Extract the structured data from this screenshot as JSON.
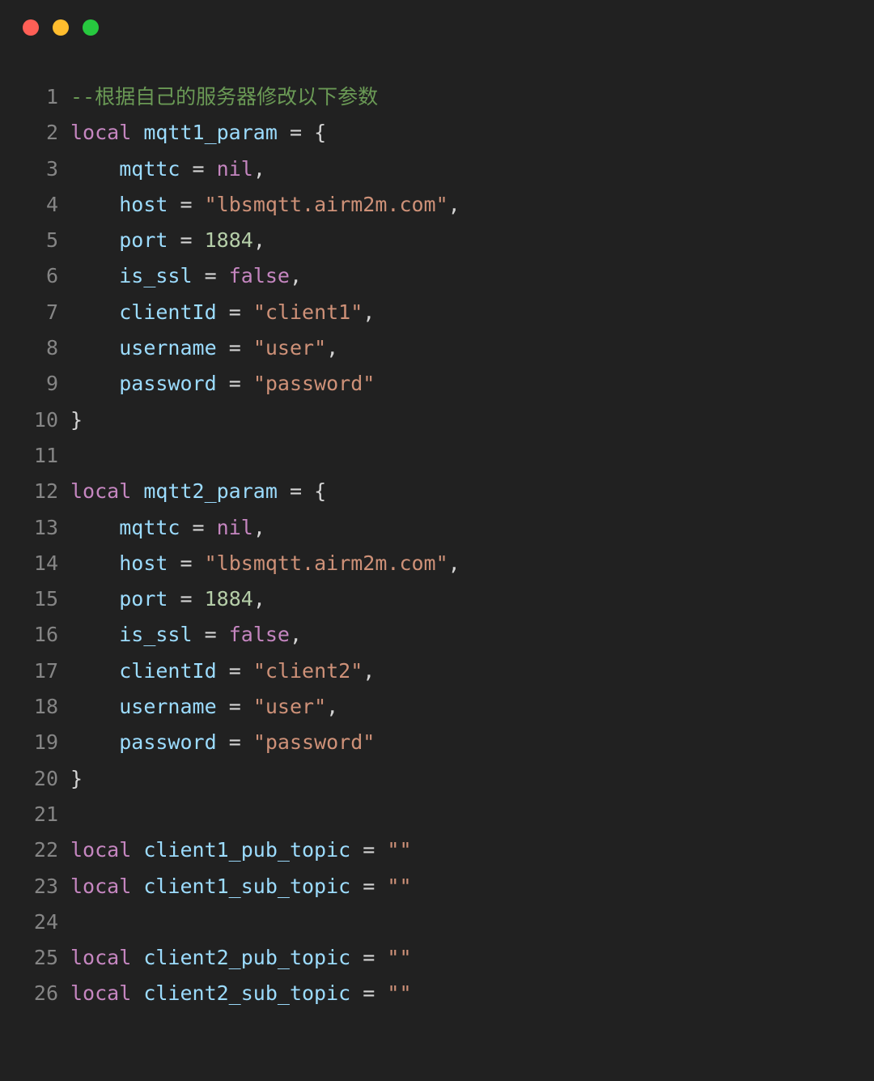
{
  "window": {
    "titlebar": {
      "buttons": [
        {
          "name": "close-button",
          "icon": "circle-icon",
          "color": "#FF5F56",
          "label": ""
        },
        {
          "name": "minimize-button",
          "icon": "circle-icon",
          "color": "#FFBD2E",
          "label": ""
        },
        {
          "name": "maximize-button",
          "icon": "circle-icon",
          "color": "#27C93F",
          "label": ""
        }
      ]
    },
    "theme": {
      "background": "#212121",
      "gutter_color": "#858585",
      "default_text": "#D4D4D4",
      "comment": "#6A9955",
      "keyword": "#C586C0",
      "identifier": "#9CDCFE",
      "string": "#CE9178",
      "number": "#B5CEA8"
    }
  },
  "editor": {
    "language": "lua",
    "first_line_number": 1,
    "last_line_number": 26,
    "lines": [
      {
        "n": "1",
        "tokens": [
          {
            "t": "--根据自己的服务器修改以下参数",
            "c": "comment"
          }
        ]
      },
      {
        "n": "2",
        "tokens": [
          {
            "t": "local",
            "c": "keyword"
          },
          {
            "t": " ",
            "c": "plain"
          },
          {
            "t": "mqtt1_param",
            "c": "ident"
          },
          {
            "t": " ",
            "c": "plain"
          },
          {
            "t": "=",
            "c": "operator"
          },
          {
            "t": " ",
            "c": "plain"
          },
          {
            "t": "{",
            "c": "punct"
          }
        ]
      },
      {
        "n": "3",
        "tokens": [
          {
            "t": "    ",
            "c": "plain"
          },
          {
            "t": "mqttc",
            "c": "ident"
          },
          {
            "t": " ",
            "c": "plain"
          },
          {
            "t": "=",
            "c": "operator"
          },
          {
            "t": " ",
            "c": "plain"
          },
          {
            "t": "nil",
            "c": "keyword"
          },
          {
            "t": ",",
            "c": "punct"
          }
        ]
      },
      {
        "n": "4",
        "tokens": [
          {
            "t": "    ",
            "c": "plain"
          },
          {
            "t": "host",
            "c": "ident"
          },
          {
            "t": " ",
            "c": "plain"
          },
          {
            "t": "=",
            "c": "operator"
          },
          {
            "t": " ",
            "c": "plain"
          },
          {
            "t": "\"lbsmqtt.airm2m.com\"",
            "c": "string"
          },
          {
            "t": ",",
            "c": "punct"
          }
        ]
      },
      {
        "n": "5",
        "tokens": [
          {
            "t": "    ",
            "c": "plain"
          },
          {
            "t": "port",
            "c": "ident"
          },
          {
            "t": " ",
            "c": "plain"
          },
          {
            "t": "=",
            "c": "operator"
          },
          {
            "t": " ",
            "c": "plain"
          },
          {
            "t": "1884",
            "c": "number"
          },
          {
            "t": ",",
            "c": "punct"
          }
        ]
      },
      {
        "n": "6",
        "tokens": [
          {
            "t": "    ",
            "c": "plain"
          },
          {
            "t": "is_ssl",
            "c": "ident"
          },
          {
            "t": " ",
            "c": "plain"
          },
          {
            "t": "=",
            "c": "operator"
          },
          {
            "t": " ",
            "c": "plain"
          },
          {
            "t": "false",
            "c": "keyword"
          },
          {
            "t": ",",
            "c": "punct"
          }
        ]
      },
      {
        "n": "7",
        "tokens": [
          {
            "t": "    ",
            "c": "plain"
          },
          {
            "t": "clientId",
            "c": "ident"
          },
          {
            "t": " ",
            "c": "plain"
          },
          {
            "t": "=",
            "c": "operator"
          },
          {
            "t": " ",
            "c": "plain"
          },
          {
            "t": "\"client1\"",
            "c": "string"
          },
          {
            "t": ",",
            "c": "punct"
          }
        ]
      },
      {
        "n": "8",
        "tokens": [
          {
            "t": "    ",
            "c": "plain"
          },
          {
            "t": "username",
            "c": "ident"
          },
          {
            "t": " ",
            "c": "plain"
          },
          {
            "t": "=",
            "c": "operator"
          },
          {
            "t": " ",
            "c": "plain"
          },
          {
            "t": "\"user\"",
            "c": "string"
          },
          {
            "t": ",",
            "c": "punct"
          }
        ]
      },
      {
        "n": "9",
        "tokens": [
          {
            "t": "    ",
            "c": "plain"
          },
          {
            "t": "password",
            "c": "ident"
          },
          {
            "t": " ",
            "c": "plain"
          },
          {
            "t": "=",
            "c": "operator"
          },
          {
            "t": " ",
            "c": "plain"
          },
          {
            "t": "\"password\"",
            "c": "string"
          }
        ]
      },
      {
        "n": "10",
        "tokens": [
          {
            "t": "}",
            "c": "punct"
          }
        ]
      },
      {
        "n": "11",
        "tokens": []
      },
      {
        "n": "12",
        "tokens": [
          {
            "t": "local",
            "c": "keyword"
          },
          {
            "t": " ",
            "c": "plain"
          },
          {
            "t": "mqtt2_param",
            "c": "ident"
          },
          {
            "t": " ",
            "c": "plain"
          },
          {
            "t": "=",
            "c": "operator"
          },
          {
            "t": " ",
            "c": "plain"
          },
          {
            "t": "{",
            "c": "punct"
          }
        ]
      },
      {
        "n": "13",
        "tokens": [
          {
            "t": "    ",
            "c": "plain"
          },
          {
            "t": "mqttc",
            "c": "ident"
          },
          {
            "t": " ",
            "c": "plain"
          },
          {
            "t": "=",
            "c": "operator"
          },
          {
            "t": " ",
            "c": "plain"
          },
          {
            "t": "nil",
            "c": "keyword"
          },
          {
            "t": ",",
            "c": "punct"
          }
        ]
      },
      {
        "n": "14",
        "tokens": [
          {
            "t": "    ",
            "c": "plain"
          },
          {
            "t": "host",
            "c": "ident"
          },
          {
            "t": " ",
            "c": "plain"
          },
          {
            "t": "=",
            "c": "operator"
          },
          {
            "t": " ",
            "c": "plain"
          },
          {
            "t": "\"lbsmqtt.airm2m.com\"",
            "c": "string"
          },
          {
            "t": ",",
            "c": "punct"
          }
        ]
      },
      {
        "n": "15",
        "tokens": [
          {
            "t": "    ",
            "c": "plain"
          },
          {
            "t": "port",
            "c": "ident"
          },
          {
            "t": " ",
            "c": "plain"
          },
          {
            "t": "=",
            "c": "operator"
          },
          {
            "t": " ",
            "c": "plain"
          },
          {
            "t": "1884",
            "c": "number"
          },
          {
            "t": ",",
            "c": "punct"
          }
        ]
      },
      {
        "n": "16",
        "tokens": [
          {
            "t": "    ",
            "c": "plain"
          },
          {
            "t": "is_ssl",
            "c": "ident"
          },
          {
            "t": " ",
            "c": "plain"
          },
          {
            "t": "=",
            "c": "operator"
          },
          {
            "t": " ",
            "c": "plain"
          },
          {
            "t": "false",
            "c": "keyword"
          },
          {
            "t": ",",
            "c": "punct"
          }
        ]
      },
      {
        "n": "17",
        "tokens": [
          {
            "t": "    ",
            "c": "plain"
          },
          {
            "t": "clientId",
            "c": "ident"
          },
          {
            "t": " ",
            "c": "plain"
          },
          {
            "t": "=",
            "c": "operator"
          },
          {
            "t": " ",
            "c": "plain"
          },
          {
            "t": "\"client2\"",
            "c": "string"
          },
          {
            "t": ",",
            "c": "punct"
          }
        ]
      },
      {
        "n": "18",
        "tokens": [
          {
            "t": "    ",
            "c": "plain"
          },
          {
            "t": "username",
            "c": "ident"
          },
          {
            "t": " ",
            "c": "plain"
          },
          {
            "t": "=",
            "c": "operator"
          },
          {
            "t": " ",
            "c": "plain"
          },
          {
            "t": "\"user\"",
            "c": "string"
          },
          {
            "t": ",",
            "c": "punct"
          }
        ]
      },
      {
        "n": "19",
        "tokens": [
          {
            "t": "    ",
            "c": "plain"
          },
          {
            "t": "password",
            "c": "ident"
          },
          {
            "t": " ",
            "c": "plain"
          },
          {
            "t": "=",
            "c": "operator"
          },
          {
            "t": " ",
            "c": "plain"
          },
          {
            "t": "\"password\"",
            "c": "string"
          }
        ]
      },
      {
        "n": "20",
        "tokens": [
          {
            "t": "}",
            "c": "punct"
          }
        ]
      },
      {
        "n": "21",
        "tokens": []
      },
      {
        "n": "22",
        "tokens": [
          {
            "t": "local",
            "c": "keyword"
          },
          {
            "t": " ",
            "c": "plain"
          },
          {
            "t": "client1_pub_topic",
            "c": "ident"
          },
          {
            "t": " ",
            "c": "plain"
          },
          {
            "t": "=",
            "c": "operator"
          },
          {
            "t": " ",
            "c": "plain"
          },
          {
            "t": "\"\"",
            "c": "string"
          }
        ]
      },
      {
        "n": "23",
        "tokens": [
          {
            "t": "local",
            "c": "keyword"
          },
          {
            "t": " ",
            "c": "plain"
          },
          {
            "t": "client1_sub_topic",
            "c": "ident"
          },
          {
            "t": " ",
            "c": "plain"
          },
          {
            "t": "=",
            "c": "operator"
          },
          {
            "t": " ",
            "c": "plain"
          },
          {
            "t": "\"\"",
            "c": "string"
          }
        ]
      },
      {
        "n": "24",
        "tokens": []
      },
      {
        "n": "25",
        "tokens": [
          {
            "t": "local",
            "c": "keyword"
          },
          {
            "t": " ",
            "c": "plain"
          },
          {
            "t": "client2_pub_topic",
            "c": "ident"
          },
          {
            "t": " ",
            "c": "plain"
          },
          {
            "t": "=",
            "c": "operator"
          },
          {
            "t": " ",
            "c": "plain"
          },
          {
            "t": "\"\"",
            "c": "string"
          }
        ]
      },
      {
        "n": "26",
        "tokens": [
          {
            "t": "local",
            "c": "keyword"
          },
          {
            "t": " ",
            "c": "plain"
          },
          {
            "t": "client2_sub_topic",
            "c": "ident"
          },
          {
            "t": " ",
            "c": "plain"
          },
          {
            "t": "=",
            "c": "operator"
          },
          {
            "t": " ",
            "c": "plain"
          },
          {
            "t": "\"\"",
            "c": "string"
          }
        ]
      }
    ]
  }
}
